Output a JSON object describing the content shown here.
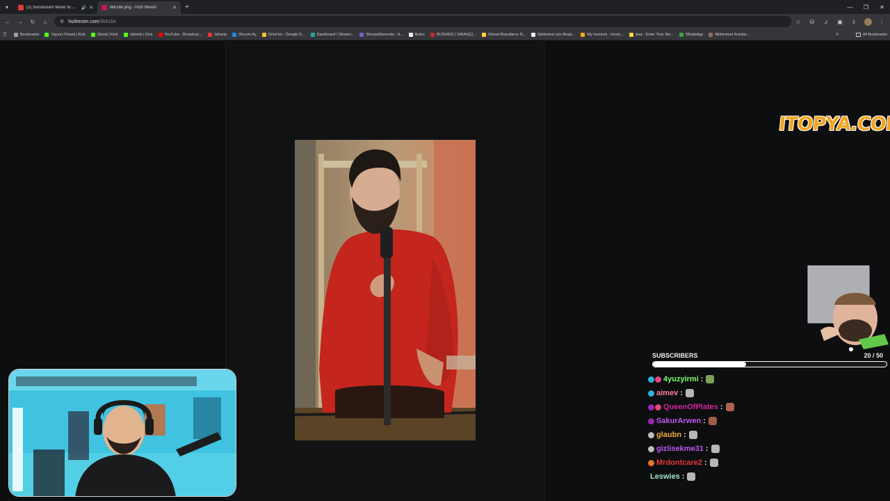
{
  "browser": {
    "tabs": [
      {
        "title": "(2) Succession Music to W...",
        "favicon_color": "#e53935",
        "active": false,
        "audio": true
      },
      {
        "title": "lIk61bk.png - Hızlı Resim",
        "favicon_color": "#c2185b",
        "active": true,
        "audio": false
      }
    ],
    "url": {
      "host": "hizliresim.com",
      "path": "/lIk61bk"
    },
    "bookmarks": [
      {
        "label": "Bookmarks",
        "color": "#9e9e9e"
      },
      {
        "label": "Yayıncı Paneli | Kick",
        "color": "#53fc18"
      },
      {
        "label": "Gözat | Kick",
        "color": "#53fc18"
      },
      {
        "label": "Jahrein | Kick",
        "color": "#53fc18"
      },
      {
        "label": "YouTube - Broadcas...",
        "color": "#ff0000"
      },
      {
        "label": "Jaharia",
        "color": "#e53935"
      },
      {
        "label": "Oturum Aç",
        "color": "#1e88e5"
      },
      {
        "label": "Drive'ım - Google D...",
        "color": "#fbc02d"
      },
      {
        "label": "Dashboard / Stream...",
        "color": "#26a69a"
      },
      {
        "label": "StreamElements - A...",
        "color": "#7e57c2"
      },
      {
        "label": "Botrix",
        "color": "#eeeeee"
      },
      {
        "label": "BUSHIDO | SAVAŞÇI...",
        "color": "#c62828"
      },
      {
        "label": "Görsel Boyutlarını N...",
        "color": "#fdd835"
      },
      {
        "label": "İşletmeniz için Akıştı...",
        "color": "#eeeeee"
      },
      {
        "label": "My Invoices - Invoic...",
        "color": "#f9a825"
      },
      {
        "label": "ikas - Enter Your Sto...",
        "color": "#fdd835"
      },
      {
        "label": "WhatsApp",
        "color": "#43a047"
      },
      {
        "label": "Mühimmat Kutuları...",
        "color": "#8d6e63"
      }
    ],
    "all_bookmarks_label": "All Bookmarks"
  },
  "overlay": {
    "sponsor_logo": "ITOPYA.COM",
    "subscribers": {
      "label": "SUBSCRIBERS",
      "current": 20,
      "goal": 50,
      "count_text": "20 / 50"
    },
    "chat": [
      {
        "user": "4yuzyirmi",
        "color": "#7dff6b",
        "badges": [
          "#2bb3d9",
          "#e0457b"
        ],
        "emote": "#7aa35a"
      },
      {
        "user": "aimev",
        "color": "#ff7e9d",
        "badges": [
          "#2bb3d9"
        ],
        "emote": "#b7b7b7"
      },
      {
        "user": "QueenOfPlates",
        "color": "#d0259b",
        "badges": [
          "#9c27b0",
          "#e0457b"
        ],
        "emote": "#b0634f"
      },
      {
        "user": "SakurArwen",
        "color": "#c056f0",
        "badges": [
          "#9c27b0"
        ],
        "emote": "#a05a48"
      },
      {
        "user": "glaubn",
        "color": "#f0a93a",
        "badges": [
          "#bdbdbd"
        ],
        "emote": "#b7b7b7"
      },
      {
        "user": "gizlisekme31",
        "color": "#c056f0",
        "badges": [
          "#bdbdbd"
        ],
        "emote": "#b7b7b7"
      },
      {
        "user": "Mrdontcare2",
        "color": "#e53935",
        "badges": [
          "#e8732a"
        ],
        "emote": "#b7b7b7"
      },
      {
        "user": "Leswies",
        "color": "#9fe0c9",
        "badges": [],
        "emote": "#b7b7b7"
      }
    ]
  }
}
